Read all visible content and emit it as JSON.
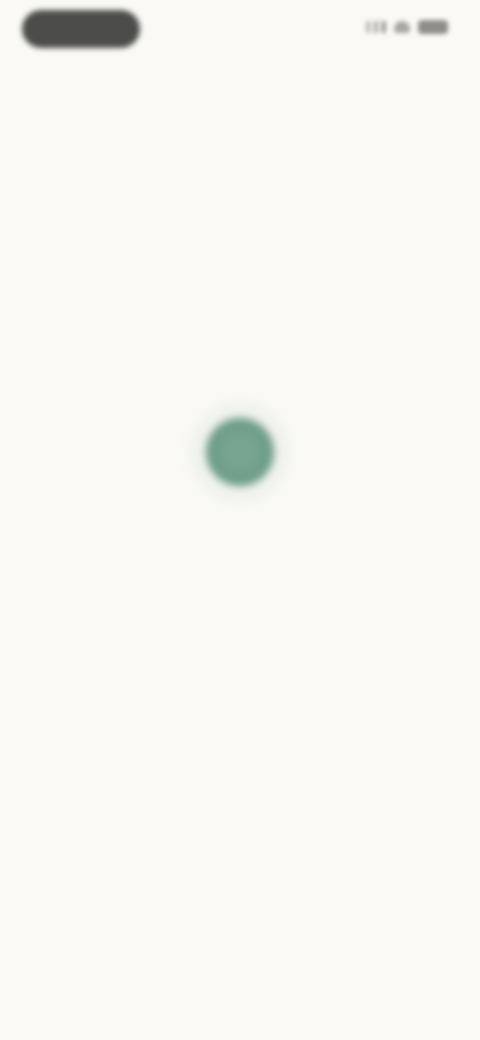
{
  "status_bar": {
    "time": "",
    "icons": [
      "signal-icon",
      "wifi-icon",
      "battery-icon"
    ]
  },
  "status": {
    "indicator_color": "#6f9e88",
    "headline": "",
    "subline": ""
  },
  "colors": {
    "background": "#faf9f6",
    "accent": "#6f9e88",
    "text_muted": "#b9b8b2",
    "text_strong": "#4d4c48"
  }
}
